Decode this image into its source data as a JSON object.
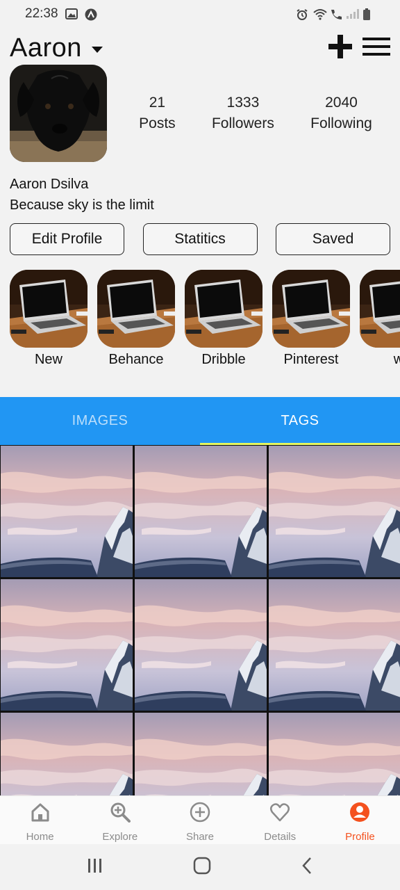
{
  "status_bar": {
    "time": "22:38",
    "left_icons": [
      "image-icon",
      "app-icon"
    ],
    "right_icons": [
      "alarm-icon",
      "wifi-icon",
      "call-icon",
      "signal-icon",
      "battery-icon"
    ]
  },
  "header": {
    "username": "Aaron",
    "actions": [
      "plus-icon",
      "menu-icon"
    ]
  },
  "profile": {
    "stats": [
      {
        "value": "21",
        "label": "Posts"
      },
      {
        "value": "1333",
        "label": "Followers"
      },
      {
        "value": "2040",
        "label": "Following"
      }
    ],
    "name": "Aaron Dsilva",
    "bio": "Because sky is the limit"
  },
  "actions": {
    "edit": "Edit Profile",
    "stats": "Statitics",
    "saved": "Saved"
  },
  "highlights": [
    "New",
    "Behance",
    "Dribble",
    "Pinterest",
    "w"
  ],
  "tabs": [
    {
      "label": "IMAGES",
      "active": false
    },
    {
      "label": "TAGS",
      "active": true
    }
  ],
  "bottom_nav": [
    {
      "label": "Home",
      "icon": "home-icon"
    },
    {
      "label": "Explore",
      "icon": "search-plus-icon"
    },
    {
      "label": "Share",
      "icon": "add-circle-icon"
    },
    {
      "label": "Details",
      "icon": "heart-icon"
    },
    {
      "label": "Profile",
      "icon": "profile-icon",
      "active": true
    }
  ],
  "colors": {
    "tab_bar": "#2196f3",
    "tab_indicator": "#e7f55e",
    "active_nav": "#f4511e"
  }
}
